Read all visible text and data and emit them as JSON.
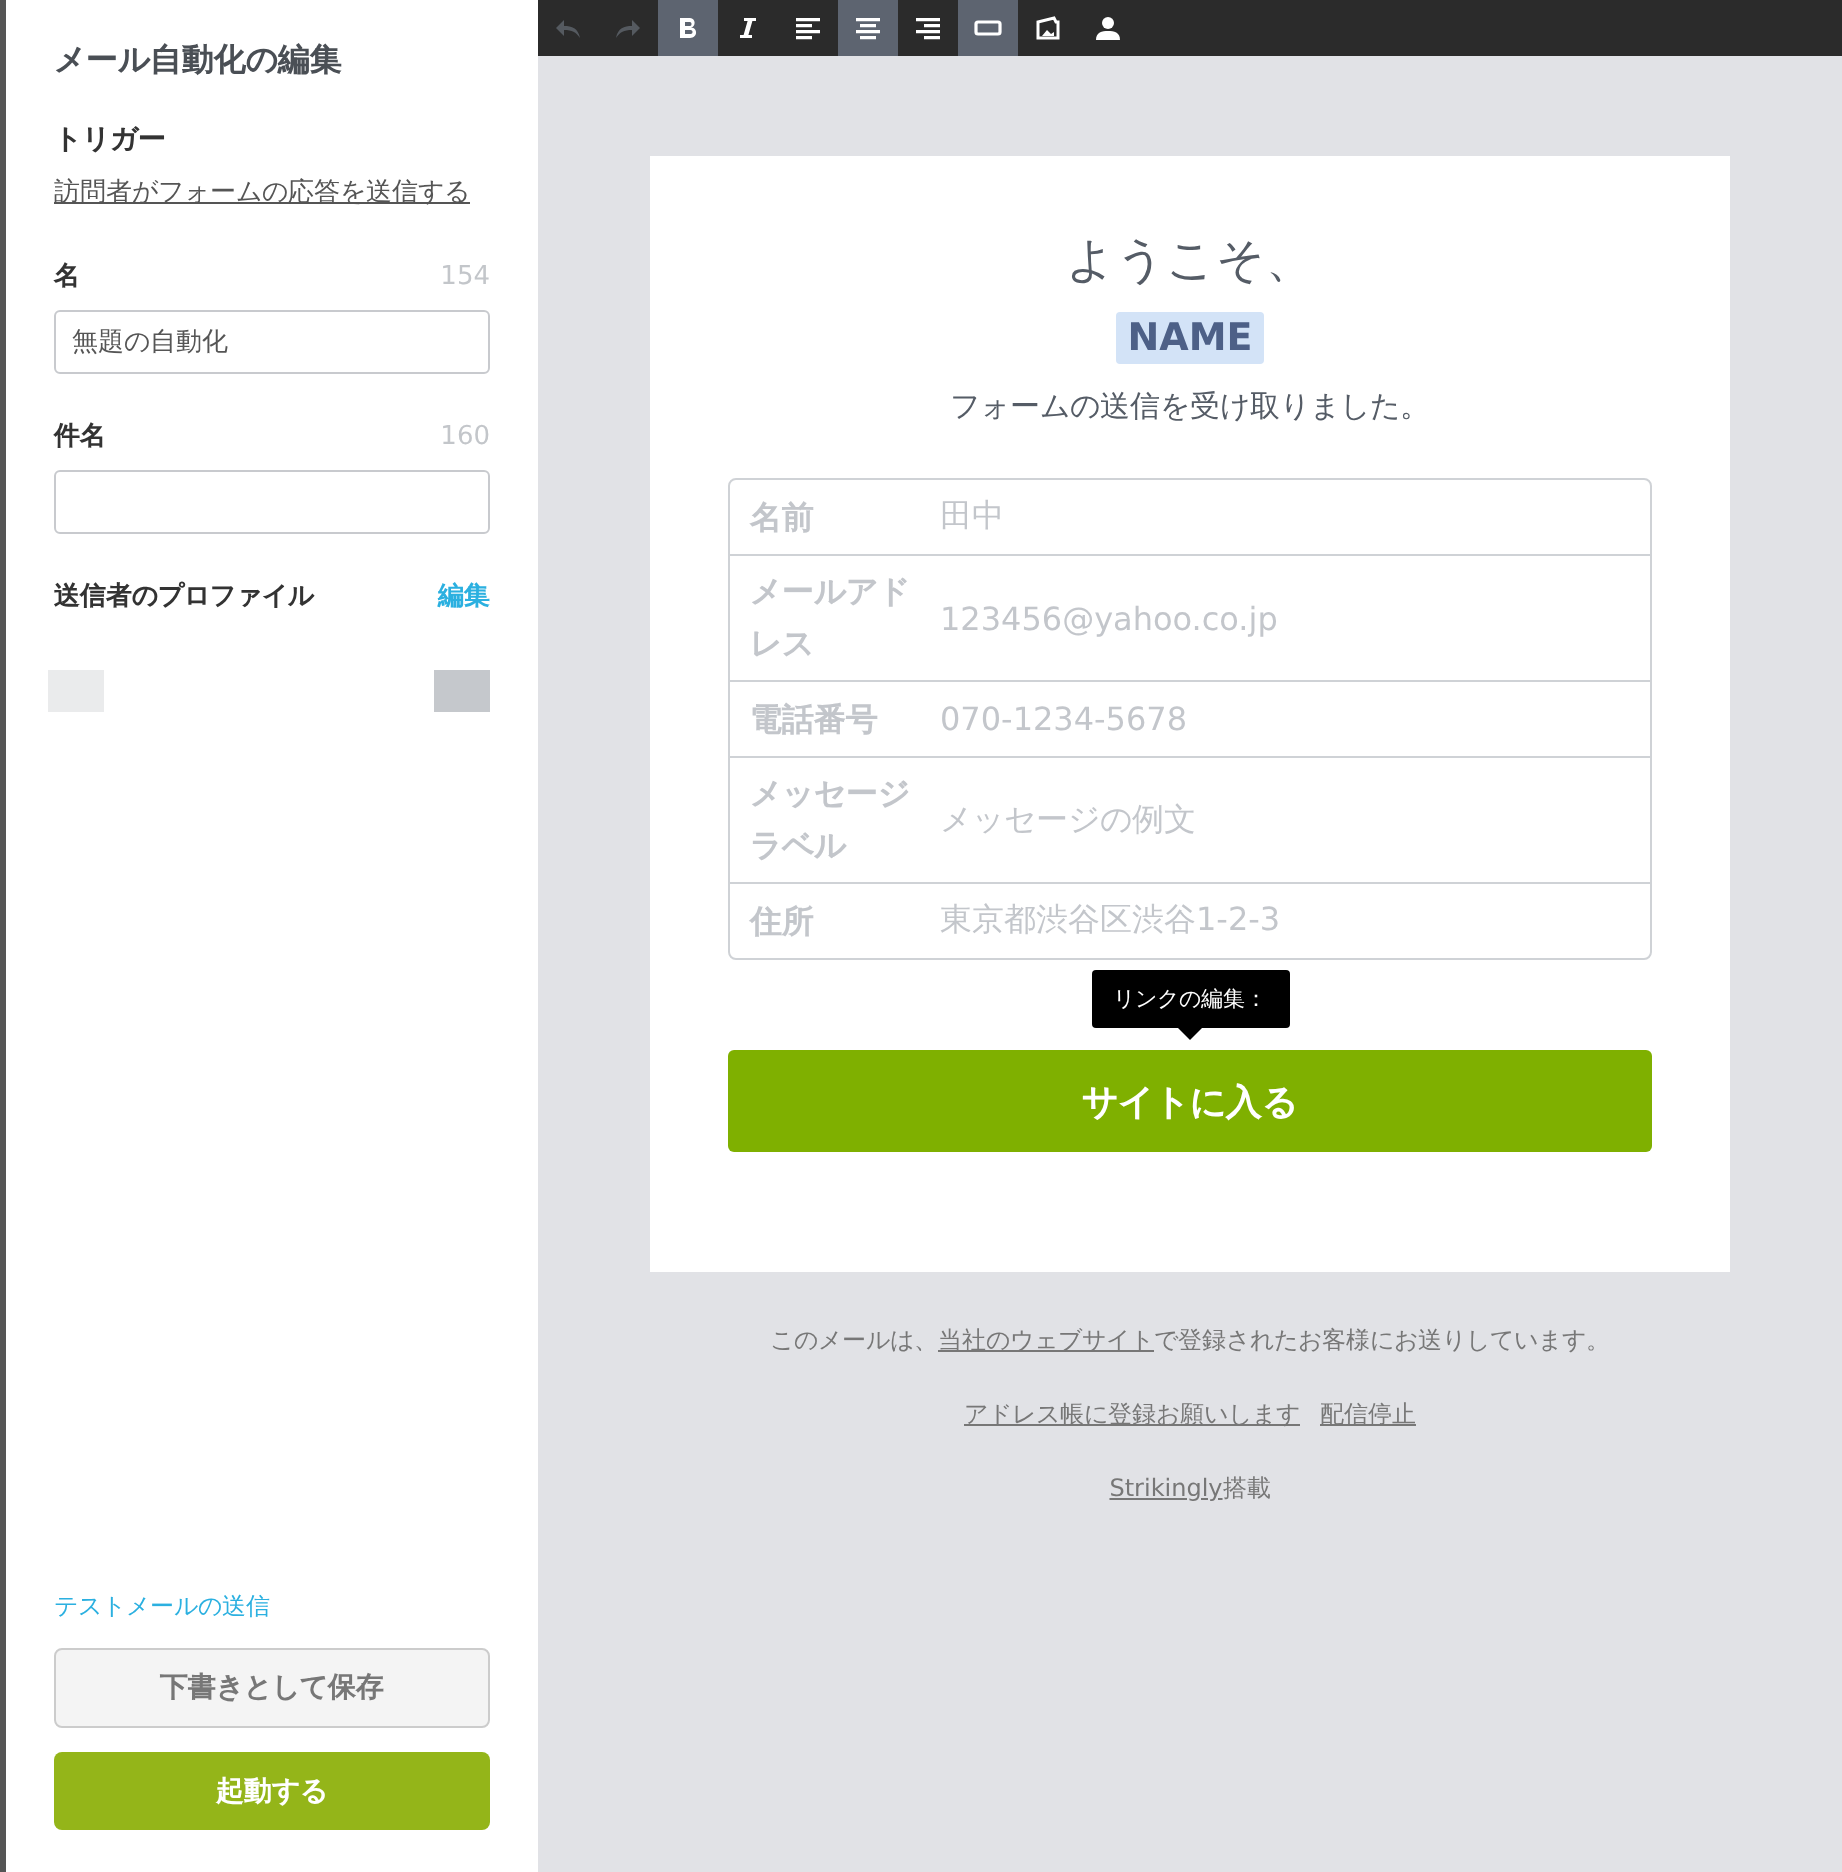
{
  "sidebar": {
    "title": "メール自動化の編集",
    "trigger": {
      "label": "トリガー",
      "link": "訪問者がフォームの応答を送信する"
    },
    "fields": [
      {
        "label": "名",
        "count": "154",
        "value": "無題の自動化"
      },
      {
        "label": "件名",
        "count": "160"
      }
    ],
    "sender": {
      "label": "送信者のプロファイル",
      "edit": "編集"
    },
    "test_link": "テストメールの送信",
    "save_button": "下書きとして保存",
    "launch_button": "起動する"
  },
  "toolbar": [
    {
      "kind": "undo",
      "selected": false,
      "disabled": true
    },
    {
      "kind": "redo",
      "selected": false,
      "disabled": true
    },
    {
      "kind": "bold",
      "selected": true,
      "disabled": false
    },
    {
      "kind": "italic",
      "selected": false,
      "disabled": false
    },
    {
      "kind": "align-left",
      "selected": false,
      "disabled": false
    },
    {
      "kind": "align-center",
      "selected": true,
      "disabled": false
    },
    {
      "kind": "align-right",
      "selected": false,
      "disabled": false
    },
    {
      "kind": "button",
      "selected": true,
      "disabled": false
    },
    {
      "kind": "image",
      "selected": false,
      "disabled": false
    },
    {
      "kind": "person",
      "selected": false,
      "disabled": false
    }
  ],
  "email": {
    "greeting": "ようこそ、",
    "name_tag": "NAME",
    "message": "フォームの送信を受け取りました。",
    "rows": [
      {
        "label": "名前",
        "value": "田中"
      },
      {
        "label": "メールアドレス",
        "value": "123456@yahoo.co.jp"
      },
      {
        "label": "電話番号",
        "value": "070-1234-5678"
      },
      {
        "label": "メッセージラベル",
        "value": "メッセージの例文"
      },
      {
        "label": "住所",
        "value": "東京都渋谷区渋谷1-2-3"
      }
    ],
    "tooltip": "リンクの編集：",
    "cta_button": "サイトに入る"
  },
  "footer": {
    "notice": {
      "before": "このメールは、",
      "link": "当社のウェブサイト",
      "after": "で登録されたお客様にお送りしています。"
    },
    "links": [
      "アドレス帳に登録お願いします",
      "配信停止"
    ],
    "powered": {
      "link": "Strikingly",
      "after": "搭載"
    }
  }
}
